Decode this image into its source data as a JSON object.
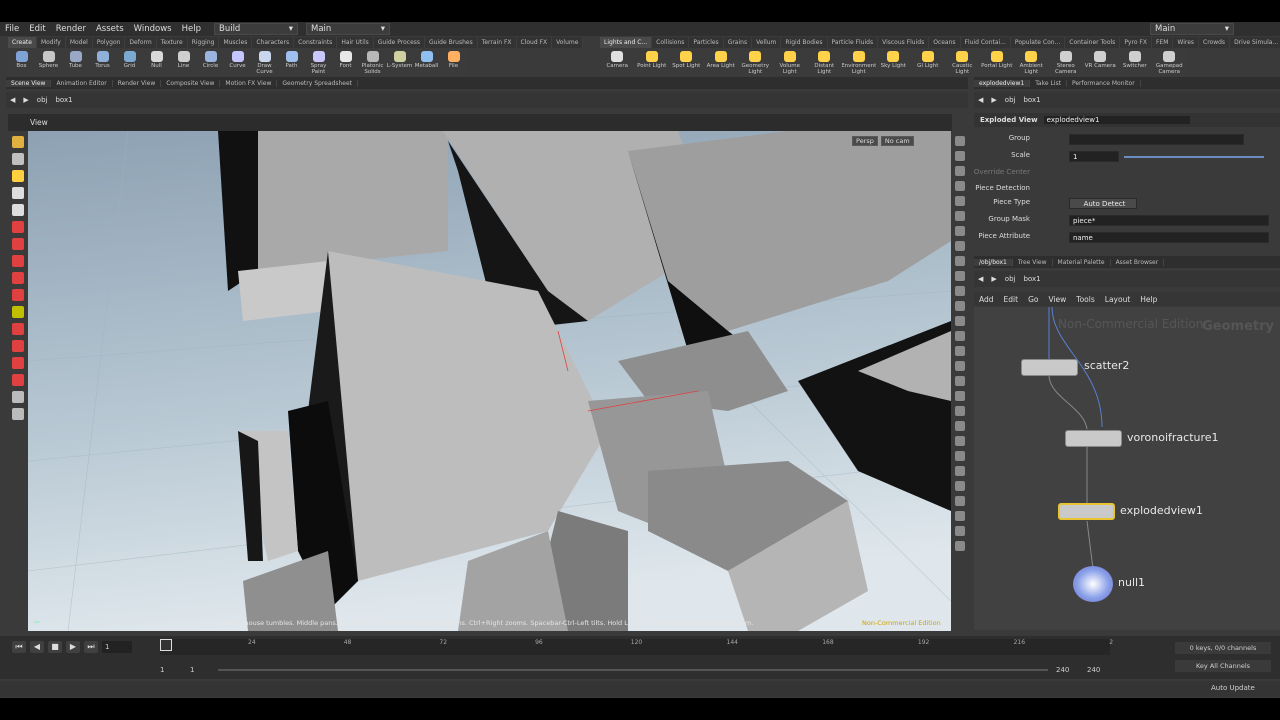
{
  "menu": [
    "File",
    "Edit",
    "Render",
    "Assets",
    "Windows",
    "Help"
  ],
  "desktop_build": "Build",
  "desktop_main": "Main",
  "right_main": "Main",
  "shelf_tabs_left": [
    "Create",
    "Modify",
    "Model",
    "Polygon",
    "Deform",
    "Texture",
    "Rigging",
    "Muscles",
    "Characters",
    "Constraints",
    "Hair Utils",
    "Guide Process",
    "Guide Brushes",
    "Terrain FX",
    "Cloud FX",
    "Volume"
  ],
  "shelf_tabs_right": [
    "Lights and C...",
    "Collisions",
    "Particles",
    "Grains",
    "Vellum",
    "Rigid Bodies",
    "Particle Fluids",
    "Viscous Fluids",
    "Oceans",
    "Fluid Contai...",
    "Populate Con...",
    "Container Tools",
    "Pyro FX",
    "FEM",
    "Wires",
    "Crowds",
    "Drive Simula..."
  ],
  "shelf_left": [
    "Box",
    "Sphere",
    "Tube",
    "Torus",
    "Grid",
    "Null",
    "Line",
    "Circle",
    "Curve",
    "Draw Curve",
    "Path",
    "Spray Paint",
    "Font",
    "Platonic Solids",
    "L-System",
    "Metaball",
    "File"
  ],
  "shelf_right": [
    "Camera",
    "Point Light",
    "Spot Light",
    "Area Light",
    "Geometry Light",
    "Volume Light",
    "Distant Light",
    "Environment Light",
    "Sky Light",
    "GI Light",
    "Caustic Light",
    "Portal Light",
    "Ambient Light",
    "Stereo Camera",
    "VR Camera",
    "Switcher",
    "Gamepad Camera"
  ],
  "pane_tabs_left": [
    "Scene View",
    "Animation Editor",
    "Render View",
    "Composite View",
    "Motion FX View",
    "Geometry Spreadsheet"
  ],
  "pane_tabs_right_top": [
    "explodedview1",
    "Take List",
    "Performance Monitor"
  ],
  "pane_tabs_right_bottom": [
    "/obj/box1",
    "Tree View",
    "Material Palette",
    "Asset Browser"
  ],
  "path": {
    "obj": "obj",
    "node": "box1"
  },
  "viewport": {
    "title": "View",
    "persp": "Persp",
    "cam": "No cam",
    "hint": "Left mouse tumbles. Middle pans. Right dollies. Ctrl+Alt+Left box-zooms. Ctrl+Right zooms. Spacebar-Ctrl-Left tilts. Hold L for alternate tumble, dolly, and zoom.",
    "watermark": "Non-Commercial Edition"
  },
  "params": {
    "type": "Exploded View",
    "name": "explodedview1",
    "group_label": "Group",
    "scale_label": "Scale",
    "scale": "1",
    "override_label": "Override Center",
    "piece_detection": "Piece Detection",
    "piece_type_label": "Piece Type",
    "piece_type": "Auto Detect",
    "group_mask_label": "Group Mask",
    "group_mask": "piece*",
    "piece_attr_label": "Piece Attribute",
    "piece_attr": "name"
  },
  "net_menu": [
    "Add",
    "Edit",
    "Go",
    "View",
    "Tools",
    "Layout",
    "Help"
  ],
  "network": {
    "title": "Geometry",
    "watermark": "Non-Commercial Edition",
    "nodes": [
      "scatter2",
      "voronoifracture1",
      "explodedview1",
      "null1"
    ]
  },
  "timeline": {
    "frame": "1",
    "ticks": [
      "24",
      "48",
      "72",
      "96",
      "120",
      "144",
      "168",
      "192",
      "216",
      "2"
    ],
    "start": "1",
    "start2": "1",
    "end": "240",
    "end2": "240",
    "keys": "0 keys, 0/0 channels",
    "key_all": "Key All Channels"
  },
  "status": {
    "auto_update": "Auto Update"
  }
}
